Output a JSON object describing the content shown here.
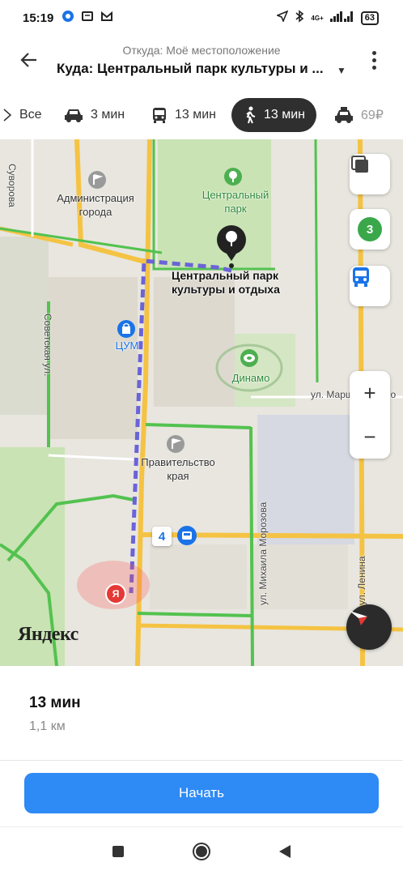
{
  "status_bar": {
    "time": "15:19",
    "battery": "63",
    "network": "4G+"
  },
  "header": {
    "from": "Откуда: Моё местоположение",
    "to": "Куда: Центральный парк культуры и ..."
  },
  "tabs": [
    {
      "label": "Все",
      "icon": "all-icon",
      "active": false
    },
    {
      "label": "3 мин",
      "icon": "car-icon",
      "active": false
    },
    {
      "label": "13 мин",
      "icon": "bus-icon",
      "active": false
    },
    {
      "label": "13 мин",
      "icon": "pedestrian-icon",
      "active": true
    },
    {
      "label": "69₽",
      "icon": "taxi-icon",
      "active": false
    }
  ],
  "map": {
    "labels": {
      "admin": "Администрация города",
      "park": "Центральный парк",
      "park_full": "Центральный парк культуры и отдыха",
      "tsum": "ЦУМ",
      "dinamo": "Динамо",
      "government": "Правительство края",
      "brand": "Яндекс"
    },
    "streets": {
      "suvorova": "Суворова",
      "sovetskaya": "Советская ул.",
      "marshala": "ул. Маршала Жуко",
      "morozova": "ул. Михаила Морозова",
      "lenina": "ул. Ленина"
    },
    "stop_number": "4",
    "traffic_badge": "3",
    "user_marker": "Я",
    "zoom_in": "+",
    "zoom_out": "−",
    "colors": {
      "route": "#6b63d8",
      "road_major": "#f5c343",
      "road_green": "#53c24f",
      "park": "#c9e3b4"
    }
  },
  "route": {
    "time": "13 мин",
    "distance": "1,1 км",
    "start_label": "Начать"
  },
  "colors": {
    "accent": "#2e8af5",
    "active_tab": "#2f2f2f"
  }
}
